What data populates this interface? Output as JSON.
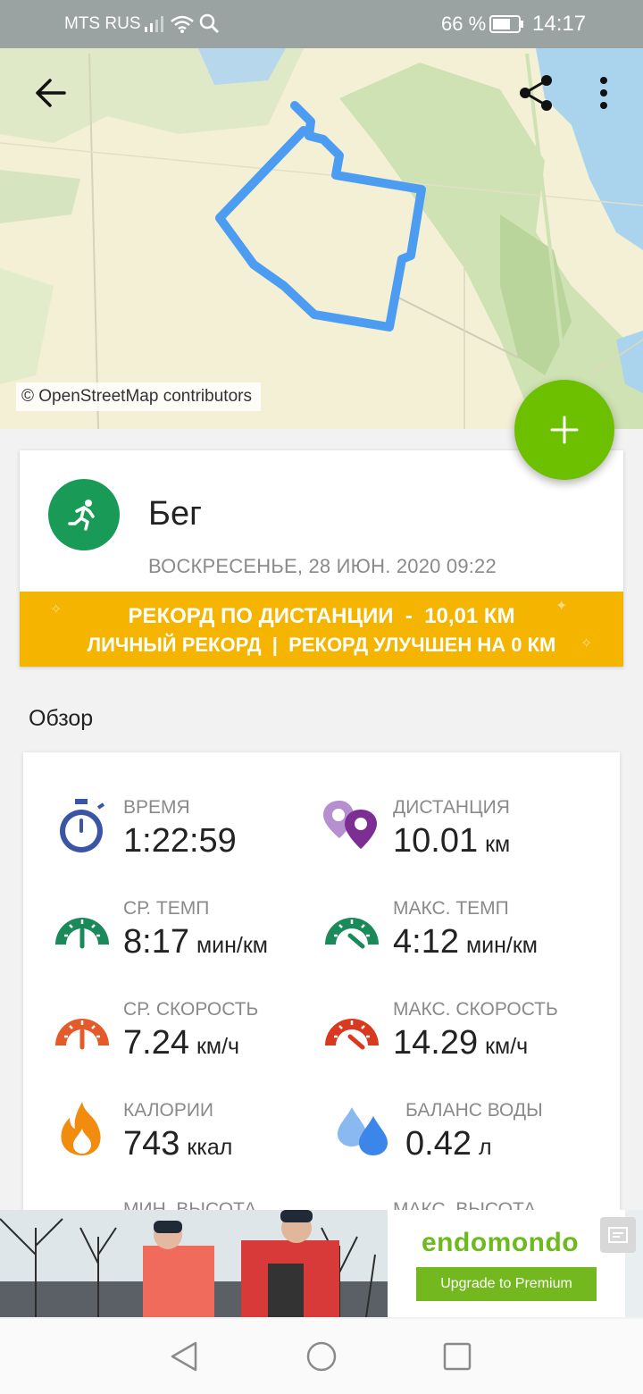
{
  "status_bar": {
    "carrier": "MTS RUS",
    "battery_percent": "66 %",
    "time": "14:17",
    "icons": [
      "signal-icon",
      "wifi-icon",
      "search-icon",
      "battery-icon"
    ]
  },
  "toolbar": {
    "back_icon": "back-arrow-icon",
    "share_icon": "share-icon",
    "menu_icon": "more-vert-icon"
  },
  "map": {
    "attribution": "© OpenStreetMap contributors",
    "route_color": "#4c9df2"
  },
  "fab": {
    "icon": "plus-icon",
    "color": "#6cc000"
  },
  "workout": {
    "sport_icon": "running-icon",
    "sport": "Бег",
    "date": "ВОСКРЕСЕНЬЕ, 28 ИЮН. 2020 09:22",
    "record_title": "РЕКОРД ПО ДИСТАНЦИИ  -  10,01 КМ",
    "record_detail": "ЛИЧНЫЙ РЕКОРД  |  РЕКОРД УЛУЧШЕН НА 0 КМ",
    "record_color": "#f4b400"
  },
  "overview": {
    "title": "Обзор",
    "stats": [
      {
        "icon": "stopwatch-icon",
        "label": "ВРЕМЯ",
        "value": "1:22:59",
        "unit": ""
      },
      {
        "icon": "distance-pin-icon",
        "label": "ДИСТАНЦИЯ",
        "value": "10.01",
        "unit": "км"
      },
      {
        "icon": "avg-pace-gauge-icon",
        "label": "СР. ТЕМП",
        "value": "8:17",
        "unit": "мин/км"
      },
      {
        "icon": "max-pace-gauge-icon",
        "label": "МАКС. ТЕМП",
        "value": "4:12",
        "unit": "мин/км"
      },
      {
        "icon": "avg-speed-gauge-icon",
        "label": "СР. СКОРОСТЬ",
        "value": "7.24",
        "unit": "км/ч"
      },
      {
        "icon": "max-speed-gauge-icon",
        "label": "МАКС. СКОРОСТЬ",
        "value": "14.29",
        "unit": "км/ч"
      },
      {
        "icon": "calories-flame-icon",
        "label": "КАЛОРИИ",
        "value": "743",
        "unit": "ккал"
      },
      {
        "icon": "water-drops-icon",
        "label": "БАЛАНС ВОДЫ",
        "value": "0.42",
        "unit": "л"
      }
    ],
    "partial_labels": [
      "МИН. ВЫСОТА",
      "МАКС. ВЫСОТА"
    ]
  },
  "ad": {
    "brand": "endomondo",
    "cta": "Upgrade to Premium",
    "close_icon": "ad-choices-icon"
  },
  "nav_bar": {
    "icons": [
      "nav-back-icon",
      "nav-home-icon",
      "nav-recents-icon"
    ]
  }
}
